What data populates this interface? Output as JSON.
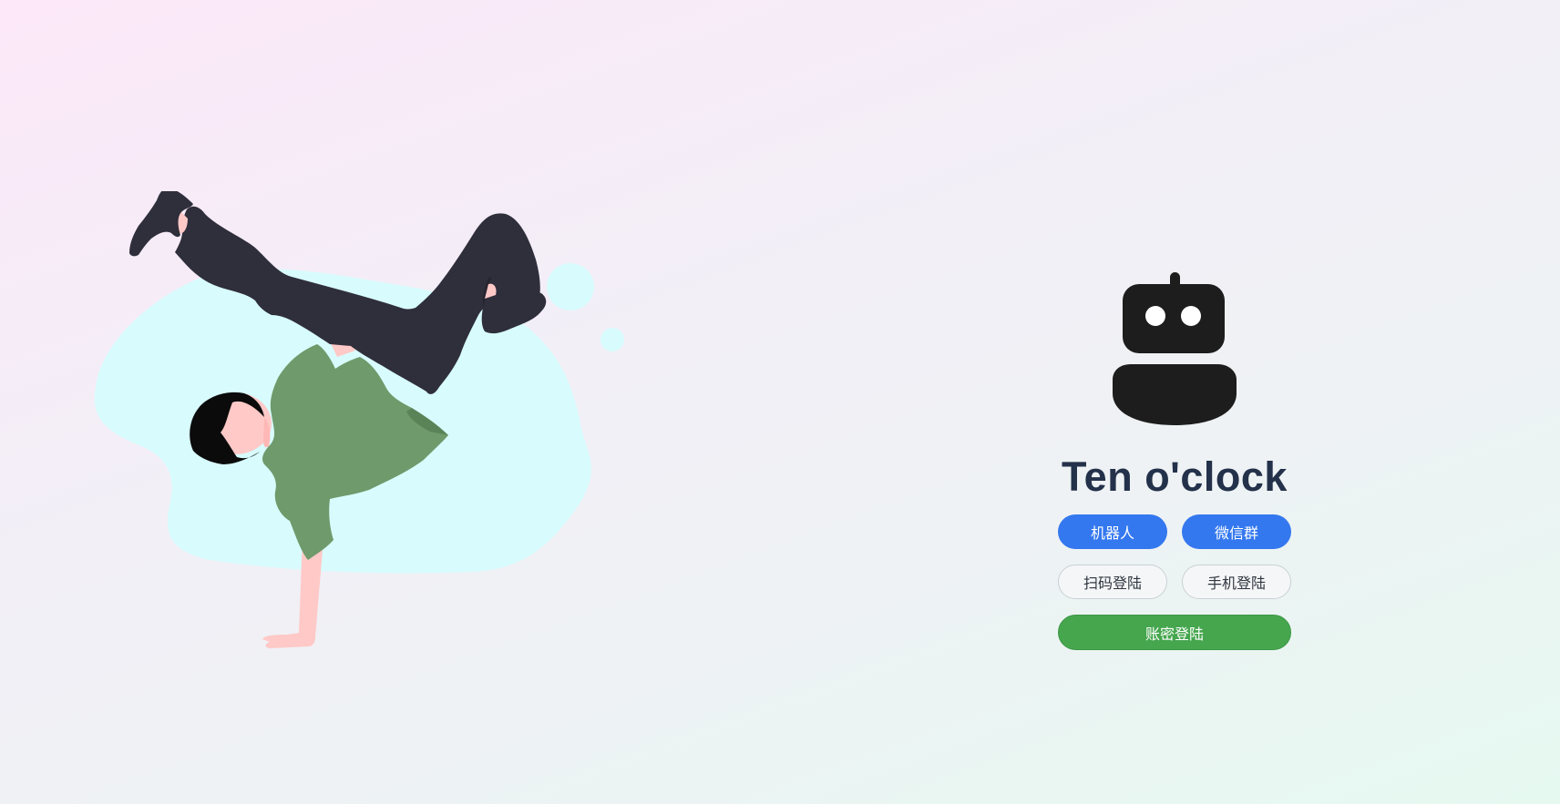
{
  "app": {
    "title": "Ten o'clock",
    "logo_icon": "robot-icon",
    "illustration": "breakdancer-illustration"
  },
  "buttons": {
    "robot_label": "机器人",
    "wechat_group_label": "微信群",
    "qr_login_label": "扫码登陆",
    "phone_login_label": "手机登陆",
    "password_login_label": "账密登陆"
  },
  "colors": {
    "primary": "#3478ef",
    "success": "#45a64e",
    "title": "#23314a",
    "blob": "#d8fcfd",
    "shirt": "#6f9a6c",
    "pants": "#2f2e3b",
    "skin": "#ffc9c7"
  }
}
